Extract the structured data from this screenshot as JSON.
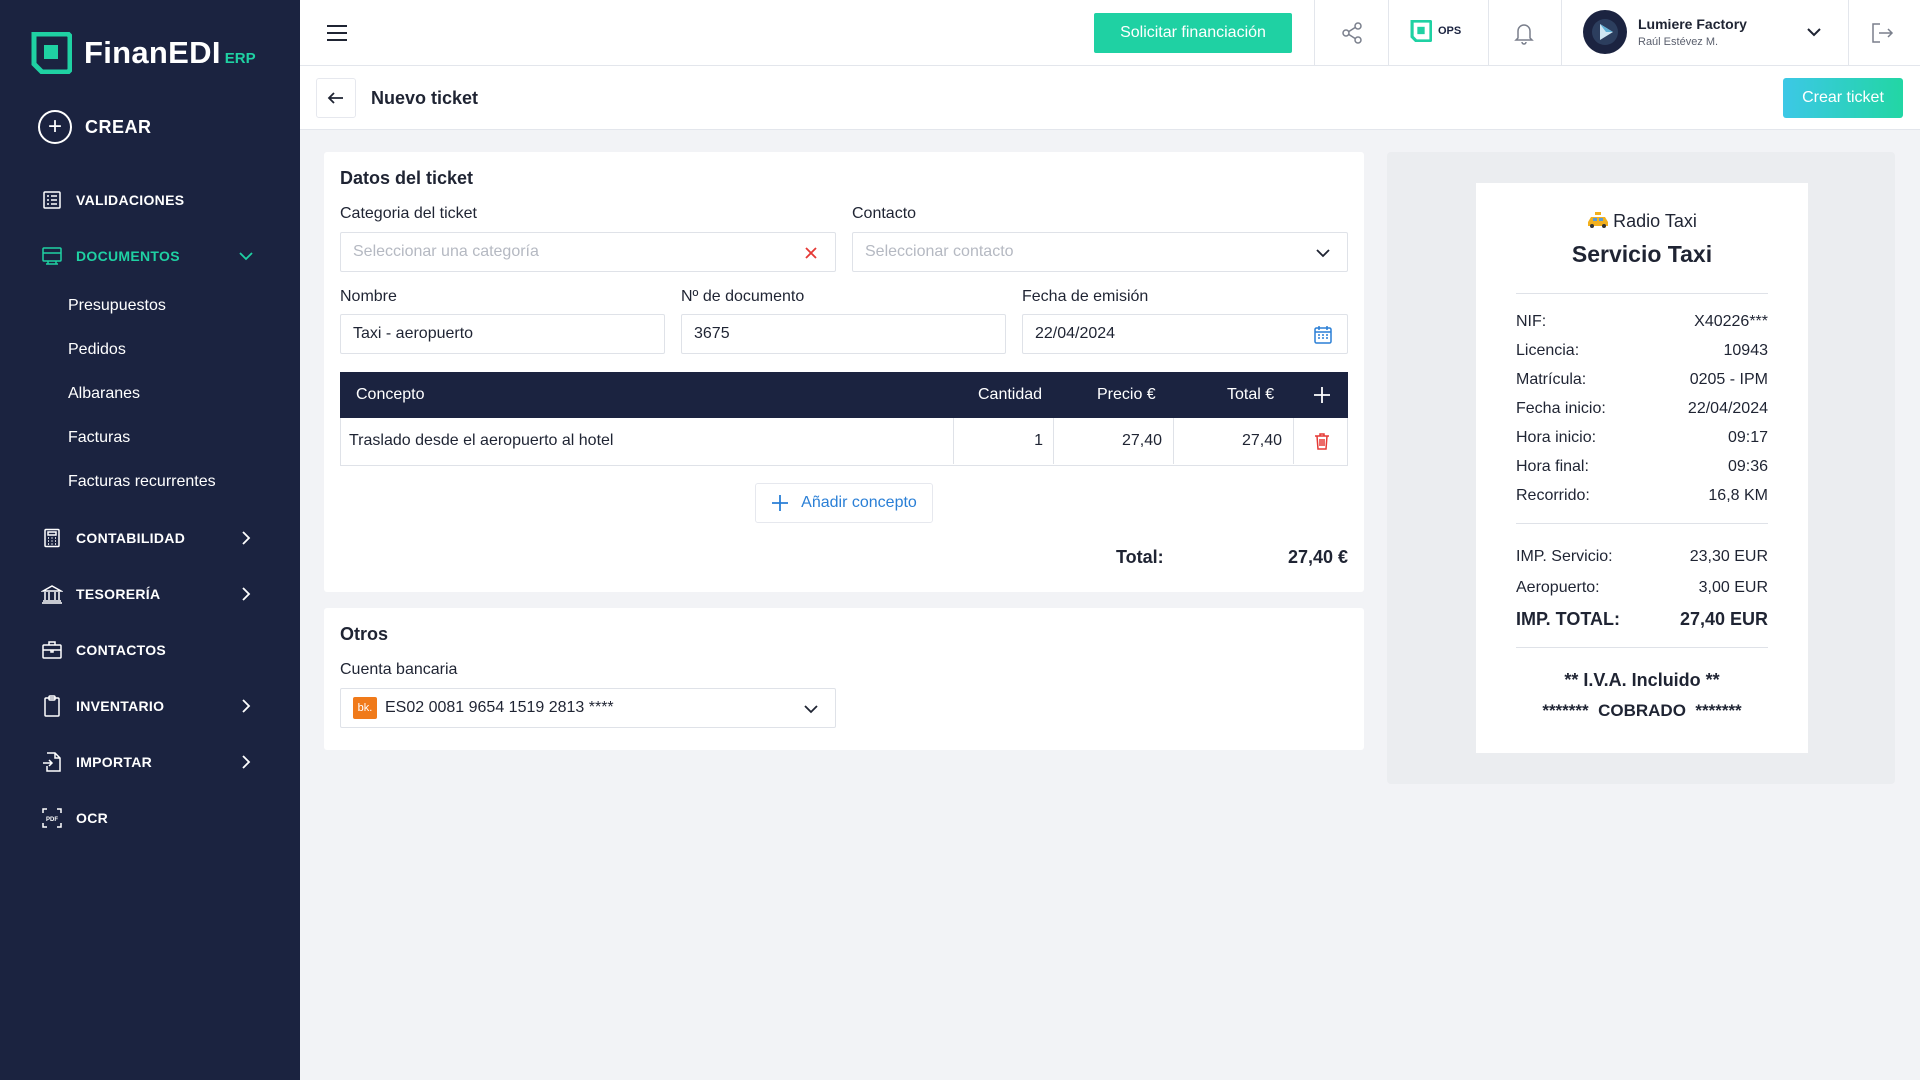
{
  "brand": {
    "name": "FinanEDI",
    "suffix": "ERP"
  },
  "sidebar": {
    "create_label": "CREAR",
    "items": [
      {
        "label": "VALIDACIONES",
        "icon": "list-check-icon"
      },
      {
        "label": "DOCUMENTOS",
        "icon": "documents-icon",
        "active": true
      },
      {
        "label": "CONTABILIDAD",
        "icon": "calculator-icon"
      },
      {
        "label": "TESORERÍA",
        "icon": "bank-icon"
      },
      {
        "label": "CONTACTOS",
        "icon": "briefcase-icon"
      },
      {
        "label": "INVENTARIO",
        "icon": "clipboard-icon"
      },
      {
        "label": "IMPORTAR",
        "icon": "import-icon"
      },
      {
        "label": "OCR",
        "icon": "pdf-scan-icon"
      }
    ],
    "documents_sub": [
      "Presupuestos",
      "Pedidos",
      "Albaranes",
      "Facturas",
      "Facturas recurrentes"
    ]
  },
  "topbar": {
    "finance_button": "Solicitar financiación",
    "ops_label": "OPS",
    "company_name": "Lumiere Factory",
    "company_user": "Raúl Estévez M."
  },
  "page": {
    "title": "Nuevo ticket",
    "create_button": "Crear ticket"
  },
  "ticket": {
    "section_title": "Datos del ticket",
    "category_label": "Categoria del ticket",
    "category_placeholder": "Seleccionar una categoría",
    "contact_label": "Contacto",
    "contact_placeholder": "Seleccionar contacto",
    "name_label": "Nombre",
    "name_value": "Taxi - aeropuerto",
    "docnum_label": "Nº de documento",
    "docnum_value": "3675",
    "date_label": "Fecha de emisión",
    "date_value": "22/04/2024",
    "table": {
      "headers": {
        "concept": "Concepto",
        "qty": "Cantidad",
        "price": "Precio €",
        "total": "Total €"
      },
      "rows": [
        {
          "concept": "Traslado desde el aeropuerto al hotel",
          "qty": "1",
          "price": "27,40",
          "total": "27,40"
        }
      ]
    },
    "add_concept": "Añadir concepto",
    "total_label": "Total:",
    "total_value": "27,40 €"
  },
  "others": {
    "section_title": "Otros",
    "bank_label": "Cuenta bancaria",
    "bank_badge": "bk.",
    "bank_value": "ES02 0081 9654 1519 2813 ****"
  },
  "receipt": {
    "company": "Radio Taxi",
    "company_icon": "taxi-icon",
    "title": "Servicio Taxi",
    "info": [
      {
        "label": "NIF:",
        "value": "X40226***"
      },
      {
        "label": "Licencia:",
        "value": "10943"
      },
      {
        "label": "Matrícula:",
        "value": "0205 - IPM"
      },
      {
        "label": "Fecha inicio:",
        "value": "22/04/2024"
      },
      {
        "label": "Hora inicio:",
        "value": "09:17"
      },
      {
        "label": "Hora final:",
        "value": "09:36"
      },
      {
        "label": "Recorrido:",
        "value": "16,8 KM"
      }
    ],
    "amounts": [
      {
        "label": "IMP. Servicio:",
        "value": "23,30 EUR"
      },
      {
        "label": "Aeropuerto:",
        "value": "3,00 EUR"
      }
    ],
    "total_label": "IMP. TOTAL:",
    "total_value": "27,40 EUR",
    "footer1": "** I.V.A. Incluido **",
    "footer2": "*******  COBRADO  *******"
  },
  "colors": {
    "sidebar": "#1b2340",
    "accent": "#1fd1a3",
    "link": "#2a7fd6",
    "danger": "#e53935"
  }
}
